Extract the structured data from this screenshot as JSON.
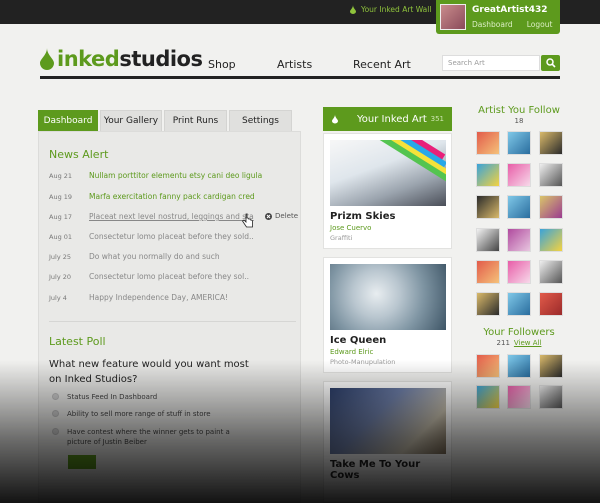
{
  "topbar": {
    "wall_link": "Your Inked Art Wall",
    "username": "GreatArtist432",
    "dashboard_link": "Dashboard",
    "logout_link": "Logout"
  },
  "logo": {
    "part1": "inked",
    "part2": "studios"
  },
  "nav": [
    "Shop",
    "Artists",
    "Recent Art"
  ],
  "search": {
    "placeholder": "Search Art"
  },
  "tabs": [
    "Dashboard",
    "Your Gallery",
    "Print Runs",
    "Settings"
  ],
  "news": {
    "title": "News Alert",
    "items": [
      {
        "date": "Aug 21",
        "text": "Nullam porttitor elementu etsy cani deo ligula",
        "style": "green"
      },
      {
        "date": "Aug 19",
        "text": "Marfa exercitation fanny pack cardigan cred",
        "style": "green"
      },
      {
        "date": "Aug 17",
        "text": "Placeat next level nostrud, leggings and sta",
        "style": "hover"
      },
      {
        "date": "Aug 01",
        "text": "Consectetur lomo placeat before they sold..",
        "style": "gray"
      },
      {
        "date": "July 25",
        "text": "Do what you normally do and such",
        "style": "gray"
      },
      {
        "date": "July 20",
        "text": "Consectetur lomo placeat before they sol..",
        "style": "gray"
      },
      {
        "date": "July 4",
        "text": "Happy Independence Day, AMERICA!",
        "style": "gray"
      }
    ],
    "delete_label": "Delete"
  },
  "poll": {
    "title": "Latest Poll",
    "question": "What new feature would you want most on Inked Studios?",
    "options": [
      "Status Feed In Dashboard",
      "Ability to sell more range of stuff in store",
      "Have contest where the winner gets to paint a picture of Justin Beiber"
    ]
  },
  "wall": {
    "title": "Your Inked Art",
    "count": "351",
    "cards": [
      {
        "title": "Prizm Skies",
        "author": "Jose Cuervo",
        "category": "Graffiti"
      },
      {
        "title": "Ice Queen",
        "author": "Edward Elric",
        "category": "Photo-Manupulation"
      },
      {
        "title": "Take Me To Your Cows",
        "author": "",
        "category": ""
      }
    ]
  },
  "following": {
    "title": "Artist You Follow",
    "count": "18"
  },
  "followers": {
    "title": "Your Followers",
    "count": "211",
    "view_all": "View All"
  },
  "colors": {
    "accent": "#5d9a1d",
    "topbar": "#222222",
    "background": "#f1f1ef"
  }
}
